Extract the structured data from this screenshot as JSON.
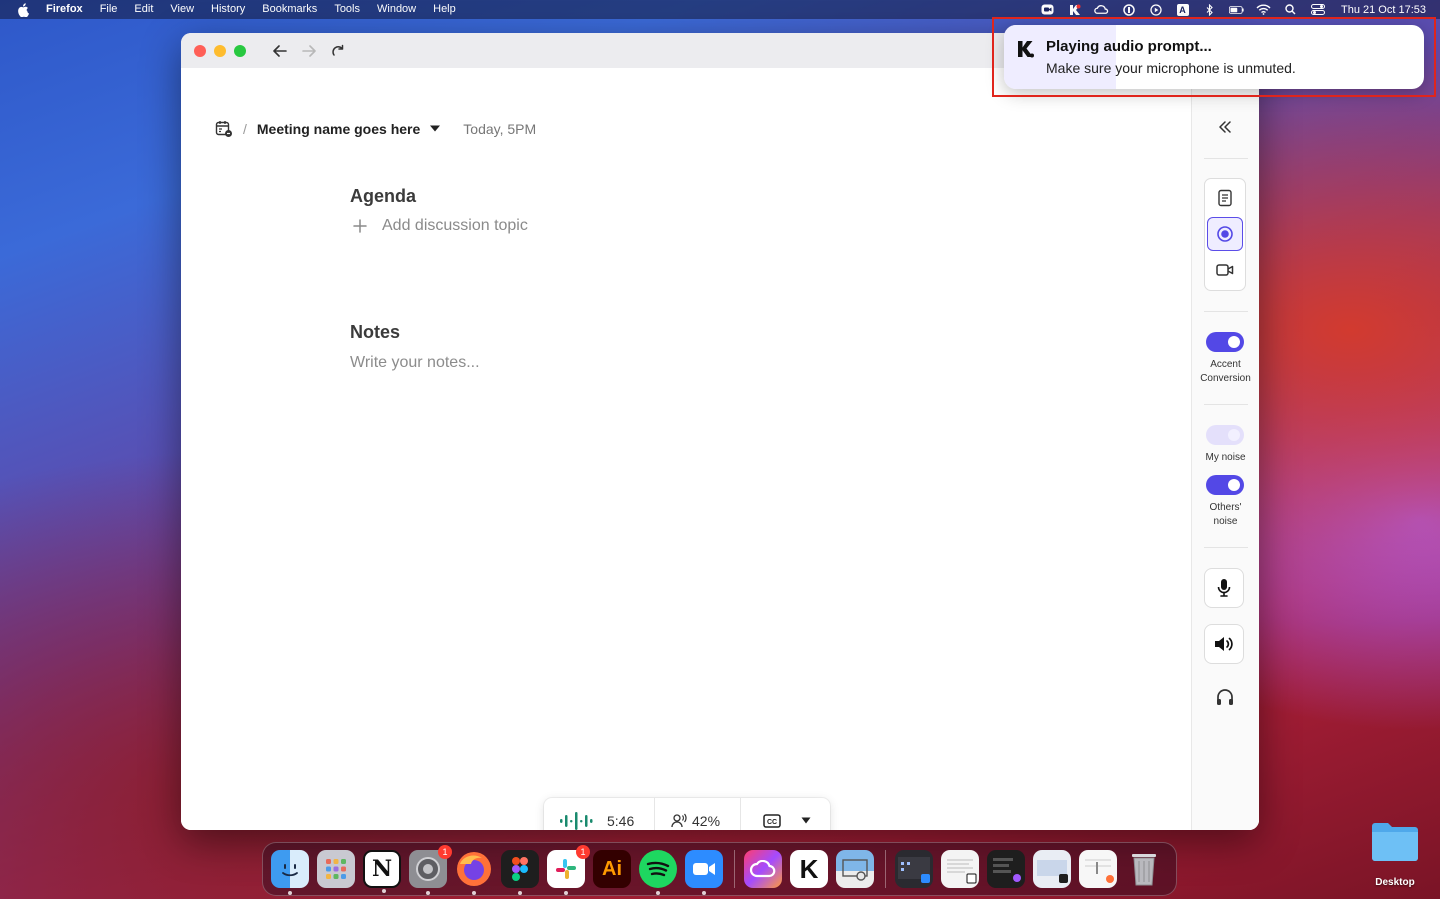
{
  "menubar": {
    "app_name": "Firefox",
    "items": [
      "File",
      "Edit",
      "View",
      "History",
      "Bookmarks",
      "Tools",
      "Window",
      "Help"
    ],
    "clock": "Thu 21 Oct  17:53",
    "input_source": "A"
  },
  "window": {
    "breadcrumb_separator": "/",
    "meeting_name": "Meeting name goes here",
    "meeting_time": "Today,  5PM"
  },
  "agenda": {
    "title": "Agenda",
    "add_topic_label": "Add discussion topic"
  },
  "notes": {
    "title": "Notes",
    "placeholder": "Write your notes..."
  },
  "status_pill": {
    "timer": "5:46",
    "talk_ratio": "42%",
    "talk_ratio_value": 0.42,
    "cc_label": "CC"
  },
  "sidebar": {
    "accent_conversion_label": "Accent Conversion",
    "accent_conversion_on": true,
    "my_noise_label": "My noise",
    "my_noise_on": true,
    "others_noise_label": "Others' noise",
    "others_noise_on": true,
    "active_mode": "record"
  },
  "toast": {
    "title": "Playing audio prompt...",
    "body": "Make sure your microphone is unmuted."
  },
  "dock": {
    "apps": [
      "finder",
      "launchpad",
      "notion",
      "system-preferences",
      "firefox",
      "figma",
      "slack",
      "illustrator",
      "spotify",
      "zoom",
      "creative-cloud",
      "krisp",
      "preview"
    ],
    "illustrator_label": "Ai",
    "notion_label": "N",
    "krisp_label": "K",
    "system_preferences_badge": "1",
    "slack_badge": "1"
  },
  "desktop": {
    "folder_label": "Desktop"
  },
  "colors": {
    "accent": "#5348e6",
    "accent_light": "#efedff",
    "highlight": "#e0251c",
    "timer_wave": "#1a8a6e"
  }
}
